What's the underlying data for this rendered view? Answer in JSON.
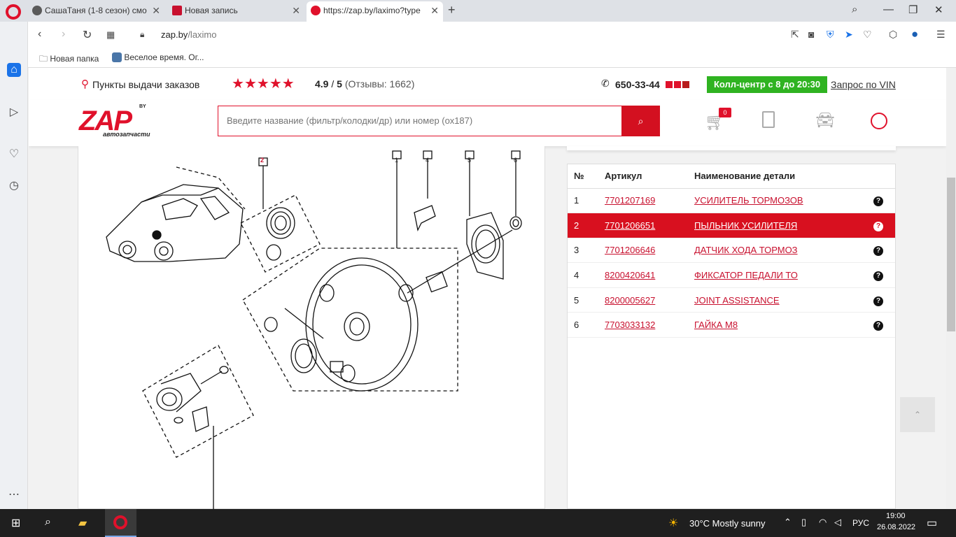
{
  "tabs": [
    {
      "label": "СашаТаня (1-8 сезон) смо",
      "fav_color": "#5a5a5a"
    },
    {
      "label": "Новая запись",
      "fav_color": "#c8102e"
    },
    {
      "label": "https://zap.by/laximo?type",
      "fav_color": "#e0112b"
    }
  ],
  "address": {
    "domain": "zap.by",
    "path": "/laximo"
  },
  "bookmarks": [
    {
      "label": "Новая папка"
    },
    {
      "label": "Веселое время. Ог..."
    }
  ],
  "header": {
    "pickup_label": "Пункты выдачи заказов",
    "rating": "4.9",
    "rating_max": "5",
    "reviews_label": "(Отзывы: 1662)",
    "phone": "650-33-44",
    "callcenter": "Колл-центр с 8 до 20:30",
    "vin_link": "Запрос по VIN"
  },
  "logo": {
    "text": "ZAP",
    "by": "BY",
    "sub": "автозапчасти"
  },
  "search": {
    "placeholder": "Введите название (фильтр/колодки/др) или номер (ох187)"
  },
  "cart": {
    "count": "0"
  },
  "table": {
    "headers": {
      "num": "№",
      "article": "Артикул",
      "name": "Наименование детали"
    },
    "rows": [
      {
        "num": "1",
        "article": "7701207169",
        "name": "УСИЛИТЕЛЬ ТОРМОЗОВ"
      },
      {
        "num": "2",
        "article": "7701206651",
        "name": "ПЫЛЬНИК УСИЛИТЕЛЯ"
      },
      {
        "num": "3",
        "article": "7701206646",
        "name": "ДАТЧИК ХОДА ТОРМОЗ"
      },
      {
        "num": "4",
        "article": "8200420641",
        "name": "ФИКСАТОР ПЕДАЛИ ТО"
      },
      {
        "num": "5",
        "article": "8200005627",
        "name": "JOINT ASSISTANCE"
      },
      {
        "num": "6",
        "article": "7703033132",
        "name": "ГАЙКА М8"
      }
    ],
    "selected_row": 2
  },
  "diagram": {
    "callouts": [
      "2",
      "1",
      "4",
      "5",
      "6"
    ]
  },
  "taskbar": {
    "weather": "30°C  Mostly sunny",
    "lang": "РУС",
    "time": "19:00",
    "date": "26.08.2022"
  },
  "colors": {
    "brand_red": "#e0112b",
    "callcenter_green": "#2fb321"
  }
}
